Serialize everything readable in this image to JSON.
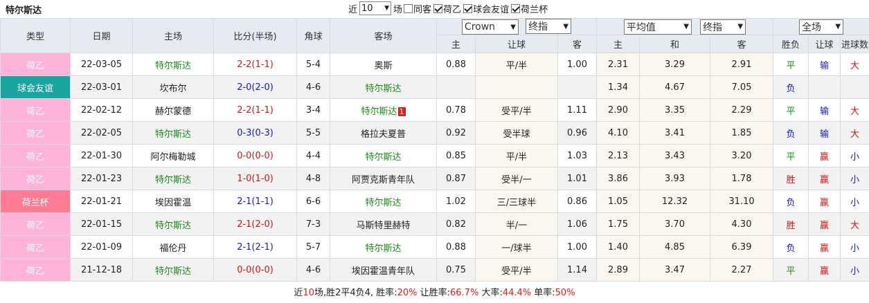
{
  "team": "特尔斯达",
  "filters": {
    "near_label": "近",
    "count": "10",
    "field_label": "场",
    "same_home_label": "同客",
    "leagues": [
      "荷乙",
      "球会友谊",
      "荷兰杯"
    ]
  },
  "header": {
    "type": "类型",
    "date": "日期",
    "home": "主场",
    "score": "比分(半场)",
    "corner": "角球",
    "away": "客场",
    "company": "Crown",
    "odds_kind": "终指",
    "avg": "平均值",
    "avg_kind": "终指",
    "scope": "全场",
    "sub": {
      "hk_home": "主",
      "hk_line": "让球",
      "hk_away": "客",
      "eu_home": "主",
      "eu_draw": "和",
      "eu_away": "客",
      "result": "胜负",
      "handicap": "让球",
      "goals": "进球数"
    }
  },
  "colors": {
    "eredivisie2": "#ffb3d9",
    "friendly": "#1aa6a0",
    "cup": "#ff7a93"
  },
  "rows": [
    {
      "type": "荷乙",
      "date": "22-03-05",
      "home": "特尔斯达",
      "score": "2-2(1-1)",
      "corner": "5-4",
      "away": "奥斯",
      "badge": "",
      "hk_home": "0.88",
      "hk_line": "平/半",
      "hk_away": "1.00",
      "eu_home": "2.31",
      "eu_draw": "3.29",
      "eu_away": "2.91",
      "result": "平",
      "handicap": "输",
      "goals": "大"
    },
    {
      "type": "球会友谊",
      "date": "22-03-01",
      "home": "坎布尔",
      "score": "2-0(2-0)",
      "corner": "4-6",
      "away": "特尔斯达",
      "badge": "",
      "hk_home": "",
      "hk_line": "",
      "hk_away": "",
      "eu_home": "1.34",
      "eu_draw": "4.67",
      "eu_away": "7.05",
      "result": "负",
      "handicap": "",
      "goals": ""
    },
    {
      "type": "荷乙",
      "date": "22-02-12",
      "home": "赫尔蒙德",
      "score": "2-2(1-1)",
      "corner": "3-4",
      "away": "特尔斯达",
      "badge": "1",
      "hk_home": "0.78",
      "hk_line": "受平/半",
      "hk_away": "1.11",
      "eu_home": "2.90",
      "eu_draw": "3.35",
      "eu_away": "2.29",
      "result": "平",
      "handicap": "输",
      "goals": "大"
    },
    {
      "type": "荷乙",
      "date": "22-02-05",
      "home": "特尔斯达",
      "score": "0-3(0-3)",
      "corner": "5-5",
      "away": "格拉夫夏普",
      "badge": "",
      "hk_home": "0.92",
      "hk_line": "受半球",
      "hk_away": "0.96",
      "eu_home": "4.10",
      "eu_draw": "3.41",
      "eu_away": "1.85",
      "result": "负",
      "handicap": "输",
      "goals": "大"
    },
    {
      "type": "荷乙",
      "date": "22-01-30",
      "home": "阿尔梅勒城",
      "score": "0-0(0-0)",
      "corner": "4-4",
      "away": "特尔斯达",
      "badge": "",
      "hk_home": "0.85",
      "hk_line": "平/半",
      "hk_away": "1.03",
      "eu_home": "2.13",
      "eu_draw": "3.43",
      "eu_away": "3.20",
      "result": "平",
      "handicap": "赢",
      "goals": "小"
    },
    {
      "type": "荷乙",
      "date": "22-01-23",
      "home": "特尔斯达",
      "score": "1-0(1-0)",
      "corner": "4-8",
      "away": "阿贾克斯青年队",
      "badge": "",
      "hk_home": "0.87",
      "hk_line": "受半/一",
      "hk_away": "1.01",
      "eu_home": "3.86",
      "eu_draw": "3.93",
      "eu_away": "1.78",
      "result": "胜",
      "handicap": "赢",
      "goals": "小"
    },
    {
      "type": "荷兰杯",
      "date": "22-01-21",
      "home": "埃因霍温",
      "score": "2-1(1-1)",
      "corner": "6-6",
      "away": "特尔斯达",
      "badge": "",
      "hk_home": "1.02",
      "hk_line": "三/三球半",
      "hk_away": "0.86",
      "eu_home": "1.05",
      "eu_draw": "12.32",
      "eu_away": "31.10",
      "result": "负",
      "handicap": "赢",
      "goals": "小"
    },
    {
      "type": "荷乙",
      "date": "22-01-15",
      "home": "特尔斯达",
      "score": "2-1(2-0)",
      "corner": "7-3",
      "away": "马斯特里赫特",
      "badge": "",
      "hk_home": "0.82",
      "hk_line": "半/一",
      "hk_away": "1.06",
      "eu_home": "1.75",
      "eu_draw": "3.70",
      "eu_away": "4.30",
      "result": "胜",
      "handicap": "赢",
      "goals": "大"
    },
    {
      "type": "荷乙",
      "date": "22-01-09",
      "home": "福伦丹",
      "score": "2-1(2-1)",
      "corner": "5-7",
      "away": "特尔斯达",
      "badge": "",
      "hk_home": "0.88",
      "hk_line": "一/球半",
      "hk_away": "1.00",
      "eu_home": "1.40",
      "eu_draw": "4.85",
      "eu_away": "6.39",
      "result": "负",
      "handicap": "赢",
      "goals": "小"
    },
    {
      "type": "荷乙",
      "date": "21-12-18",
      "home": "特尔斯达",
      "score": "0-0(0-0)",
      "corner": "4-6",
      "away": "埃因霍温青年队",
      "badge": "",
      "hk_home": "0.75",
      "hk_line": "受平/半",
      "hk_away": "1.14",
      "eu_home": "2.89",
      "eu_draw": "3.47",
      "eu_away": "2.27",
      "result": "平",
      "handicap": "赢",
      "goals": "小"
    }
  ],
  "summary": {
    "p1": "近",
    "n_games": "10",
    "p2": "场,胜2平4负4, 胜率:",
    "win_rate": "20%",
    "p3": " 让胜率:",
    "hk_rate": "66.7%",
    "p4": " 大率:",
    "big_rate": "44.4%",
    "p5": " 单率:",
    "odd_rate": "50%"
  }
}
